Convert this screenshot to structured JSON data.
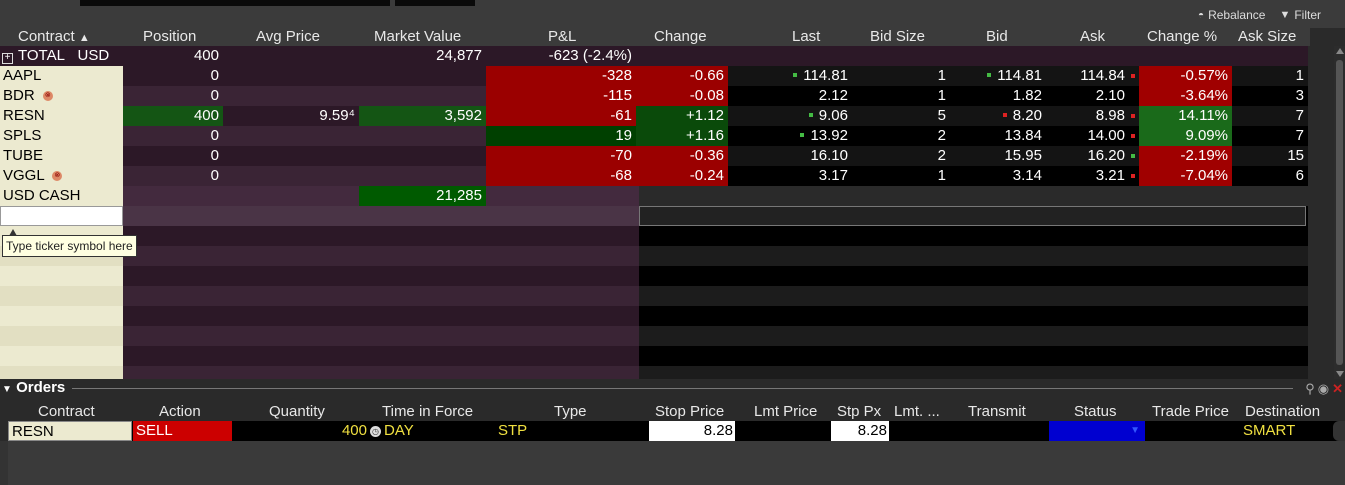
{
  "toolbar": {
    "rebalance": "Rebalance",
    "filter": "Filter"
  },
  "columns": {
    "contract": "Contract",
    "position": "Position",
    "avg_price": "Avg Price",
    "market_value": "Market Value",
    "pnl": "P&L",
    "change": "Change",
    "last": "Last",
    "bid_size": "Bid Size",
    "bid": "Bid",
    "ask": "Ask",
    "change_pct": "Change %",
    "ask_size": "Ask Size"
  },
  "total": {
    "label": "TOTAL",
    "currency": "USD",
    "position": "400",
    "market_value": "24,877",
    "pnl": "-623 (-2.4%)"
  },
  "rows": [
    {
      "contract": "AAPL",
      "position": "0",
      "avg_price": "",
      "market_value": "",
      "pnl": "-328",
      "change": "-0.66",
      "last": "114.81",
      "bid_size": "1",
      "bid": "114.81",
      "ask": "114.84",
      "change_pct": "-0.57%",
      "ask_size": "1"
    },
    {
      "contract": "BDR",
      "position": "0",
      "avg_price": "",
      "market_value": "",
      "pnl": "-115",
      "change": "-0.08",
      "last": "2.12",
      "bid_size": "1",
      "bid": "1.82",
      "ask": "2.10",
      "change_pct": "-3.64%",
      "ask_size": "3"
    },
    {
      "contract": "RESN",
      "position": "400",
      "avg_price": "9.59⁴",
      "market_value": "3,592",
      "pnl": "-61",
      "change": "+1.12",
      "last": "9.06",
      "bid_size": "5",
      "bid": "8.20",
      "ask": "8.98",
      "change_pct": "14.11%",
      "ask_size": "7"
    },
    {
      "contract": "SPLS",
      "position": "0",
      "avg_price": "",
      "market_value": "",
      "pnl": "19",
      "change": "+1.16",
      "last": "13.92",
      "bid_size": "2",
      "bid": "13.84",
      "ask": "14.00",
      "change_pct": "9.09%",
      "ask_size": "7"
    },
    {
      "contract": "TUBE",
      "position": "0",
      "avg_price": "",
      "market_value": "",
      "pnl": "-70",
      "change": "-0.36",
      "last": "16.10",
      "bid_size": "2",
      "bid": "15.95",
      "ask": "16.20",
      "change_pct": "-2.19%",
      "ask_size": "15"
    },
    {
      "contract": "VGGL",
      "position": "0",
      "avg_price": "",
      "market_value": "",
      "pnl": "-68",
      "change": "-0.24",
      "last": "3.17",
      "bid_size": "1",
      "bid": "3.14",
      "ask": "3.21",
      "change_pct": "-7.04%",
      "ask_size": "6"
    }
  ],
  "cash": {
    "label": "USD CASH",
    "market_value": "21,285"
  },
  "ticker_input": {
    "placeholder": "",
    "tooltip": "Type ticker symbol here"
  },
  "orders": {
    "title": "Orders",
    "columns": {
      "contract": "Contract",
      "action": "Action",
      "quantity": "Quantity",
      "tif": "Time in Force",
      "type": "Type",
      "stop_price": "Stop Price",
      "lmt_price": "Lmt Price",
      "stp_px": "Stp Px",
      "lmt_dots": "Lmt. ...",
      "transmit": "Transmit",
      "status": "Status",
      "trade_price": "Trade Price",
      "destination": "Destination"
    },
    "row": {
      "contract": "RESN",
      "action": "SELL",
      "quantity": "400",
      "tif": "DAY",
      "type": "STP",
      "stop_price": "8.28",
      "stp_px": "8.28",
      "destination": "SMART"
    }
  },
  "colors": {
    "red": "#9b0000",
    "bright_red": "#c80000",
    "green": "#006400",
    "dark_green": "#004d00",
    "purple_dark": "#2c1827",
    "purple_mid": "#432a3e",
    "cream": "#ecead0",
    "yellow": "#f0e040",
    "blue": "#0000d0"
  }
}
